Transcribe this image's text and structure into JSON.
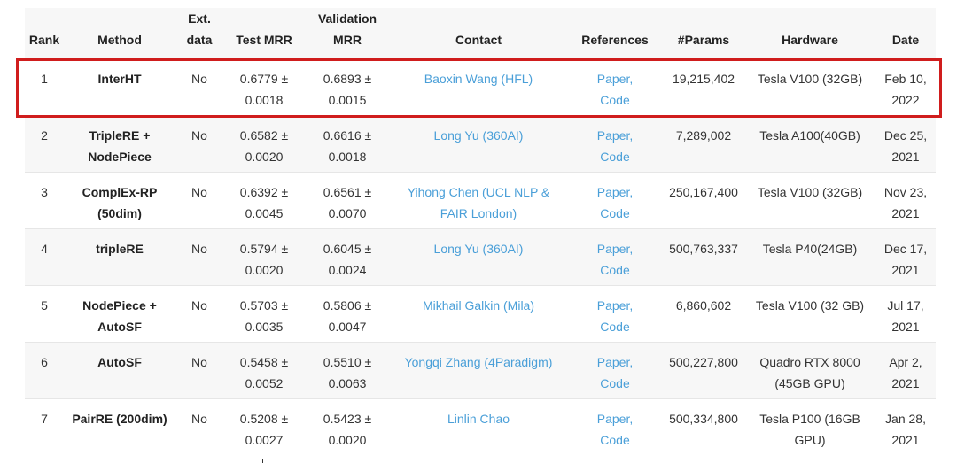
{
  "columns": {
    "rank": "Rank",
    "method": "Method",
    "ext_data_1": "Ext.",
    "ext_data_2": "data",
    "test_mrr": "Test MRR",
    "val_mrr_1": "Validation",
    "val_mrr_2": "MRR",
    "contact": "Contact",
    "references": "References",
    "params": "#Params",
    "hardware": "Hardware",
    "date": "Date"
  },
  "rows": [
    {
      "rank": "1",
      "method": "InterHT",
      "ext": "No",
      "test": "0.6779 ± 0.0018",
      "val": "0.6893 ± 0.0015",
      "contact": "Baoxin Wang (HFL)",
      "paper": "Paper,",
      "code": "Code",
      "params": "19,215,402",
      "hardware": "Tesla V100 (32GB)",
      "date": "Feb 10, 2022"
    },
    {
      "rank": "2",
      "method": "TripleRE + NodePiece",
      "ext": "No",
      "test": "0.6582 ± 0.0020",
      "val": "0.6616 ± 0.0018",
      "contact": "Long Yu (360AI)",
      "paper": "Paper,",
      "code": "Code",
      "params": "7,289,002",
      "hardware": "Tesla A100(40GB)",
      "date": "Dec 25, 2021"
    },
    {
      "rank": "3",
      "method": "ComplEx-RP (50dim)",
      "ext": "No",
      "test": "0.6392 ± 0.0045",
      "val": "0.6561 ± 0.0070",
      "contact": "Yihong Chen (UCL NLP & FAIR London)",
      "paper": "Paper,",
      "code": "Code",
      "params": "250,167,400",
      "hardware": "Tesla V100 (32GB)",
      "date": "Nov 23, 2021"
    },
    {
      "rank": "4",
      "method": "tripleRE",
      "ext": "No",
      "test": "0.5794 ± 0.0020",
      "val": "0.6045 ± 0.0024",
      "contact": "Long Yu (360AI)",
      "paper": "Paper,",
      "code": "Code",
      "params": "500,763,337",
      "hardware": "Tesla P40(24GB)",
      "date": "Dec 17, 2021"
    },
    {
      "rank": "5",
      "method": "NodePiece + AutoSF",
      "ext": "No",
      "test": "0.5703 ± 0.0035",
      "val": "0.5806 ± 0.0047",
      "contact": "Mikhail Galkin (Mila)",
      "paper": "Paper,",
      "code": "Code",
      "params": "6,860,602",
      "hardware": "Tesla V100 (32 GB)",
      "date": "Jul 17, 2021"
    },
    {
      "rank": "6",
      "method": "AutoSF",
      "ext": "No",
      "test": "0.5458 ± 0.0052",
      "val": "0.5510 ± 0.0063",
      "contact": "Yongqi Zhang (4Paradigm)",
      "paper": "Paper,",
      "code": "Code",
      "params": "500,227,800",
      "hardware": "Quadro RTX 8000 (45GB GPU)",
      "date": "Apr 2, 2021"
    },
    {
      "rank": "7",
      "method": "PairRE (200dim)",
      "ext": "No",
      "test": "0.5208 ± 0.0027",
      "val": "0.5423 ± 0.0020",
      "contact": "Linlin Chao",
      "paper": "Paper,",
      "code": "Code",
      "params": "500,334,800",
      "hardware": "Tesla P100 (16GB GPU)",
      "date": "Jan 28, 2021"
    }
  ],
  "colors": {
    "link": "#4a9fd8",
    "highlight": "#d01d1d",
    "stripe": "#f7f7f7"
  }
}
